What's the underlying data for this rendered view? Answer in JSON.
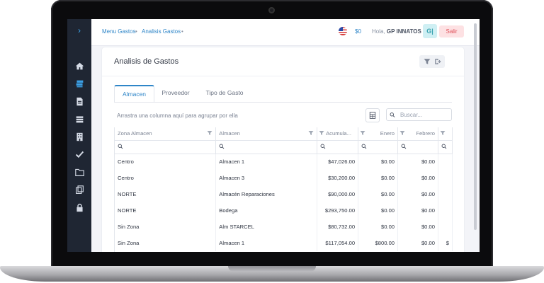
{
  "breadcrumb": [
    "Menu Gastos",
    "Analisis Gastos"
  ],
  "header": {
    "balance": "$0",
    "greeting": "Hola,",
    "user_name": "GP INNATOS",
    "avatar_initials": "G|",
    "logout_label": "Salir"
  },
  "sidebar": {
    "items": [
      "chevron-right-icon",
      "home-icon",
      "layers-icon",
      "document-icon",
      "stack-icon",
      "building-icon",
      "check-icon",
      "folder-icon",
      "copy-icon",
      "lock-icon"
    ]
  },
  "page": {
    "title": "Analisis de Gastos"
  },
  "tabs": [
    {
      "label": "Almacen",
      "active": true
    },
    {
      "label": "Proveedor",
      "active": false
    },
    {
      "label": "Tipo de Gasto",
      "active": false
    }
  ],
  "toolbar": {
    "group_hint": "Arrastra una columna aquí para agrupar por ella",
    "search_placeholder": "Buscar..."
  },
  "grid": {
    "columns": [
      "Zona Almacen",
      "Almacen",
      "Acumula...",
      "Enero",
      "Febrero",
      ""
    ],
    "rows": [
      [
        "Centro",
        "Almacen 1",
        "$47,026.00",
        "$0.00",
        "$0.00",
        ""
      ],
      [
        "Centro",
        "Almacen 3",
        "$30,200.00",
        "$0.00",
        "$0.00",
        ""
      ],
      [
        "NORTE",
        "Almacén Reparaciones",
        "$90,000.00",
        "$0.00",
        "$0.00",
        ""
      ],
      [
        "NORTE",
        "Bodega",
        "$293,750.00",
        "$0.00",
        "$0.00",
        ""
      ],
      [
        "Sin Zona",
        "Alm STARCEL",
        "$80,732.00",
        "$0.00",
        "$0.00",
        ""
      ],
      [
        "Sin Zona",
        "Almacen 1",
        "$117,054.00",
        "$800.00",
        "$0.00",
        "$"
      ]
    ]
  },
  "colors": {
    "accent": "#2f86c8",
    "sidebar": "#1f2633",
    "logout_bg": "#fde1e3"
  }
}
